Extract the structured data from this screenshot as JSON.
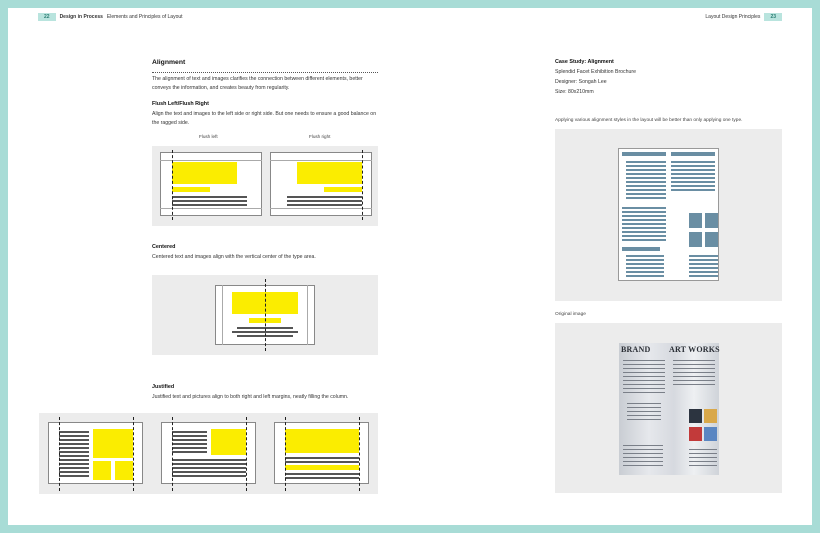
{
  "header": {
    "left_page_number": "22",
    "left_section": "Design in Process",
    "left_subsection": "Elements and Principles of Layout",
    "right_section": "Layout Design Principles",
    "right_page_number": "23"
  },
  "left": {
    "title": "Alignment",
    "intro": "The alignment of text and images clarifies the connection between different elements, better conveys the information, and creates beauty from regularity.",
    "flush_heading": "Flush Left/Flush Right",
    "flush_body": "Align the text and images to the left side or right side. But one needs to ensure a good balance on the ragged side.",
    "flush_left_caption": "Flush left",
    "flush_right_caption": "Flush right",
    "centered_heading": "Centered",
    "centered_body": "Centered text and images align with the vertical center of the type area.",
    "justified_heading": "Justified",
    "justified_body": "Justified text and pictures align to both right and left margins, neatly filling the column."
  },
  "right": {
    "case_title": "Case Study: Alignment",
    "case_project": "Splendid Facet Exhibition Brochure",
    "case_designer": "Designer: Songah Lee",
    "case_size": "Size: 80x210mm",
    "caption_top": "Applying various alignment styles in the layout will be better than only applying one type.",
    "caption_original": "Original image",
    "photo_title_left": "BRAND",
    "photo_title_right": "ART WORKS"
  },
  "colors": {
    "border": "#a8dcd6",
    "accent_yellow": "#fbed00",
    "diagram_blue": "#6a8ea3",
    "panel_gray": "#ececec"
  }
}
